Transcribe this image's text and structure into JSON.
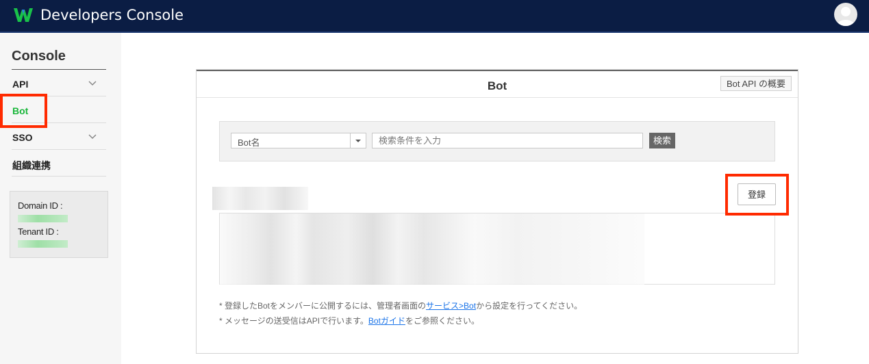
{
  "header": {
    "title": "Developers Console",
    "logo_color": "#19c24a",
    "bg_color": "#0b1d44"
  },
  "sidebar": {
    "heading": "Console",
    "items": [
      {
        "label": "API",
        "expandable": true
      },
      {
        "label": "Bot",
        "active": true
      },
      {
        "label": "SSO",
        "expandable": true
      },
      {
        "label": "組織連携"
      }
    ],
    "domain_id_label": "Domain ID :",
    "tenant_id_label": "Tenant ID :"
  },
  "panel": {
    "title": "Bot",
    "overview_button": "Bot API の概要",
    "search": {
      "field_select": "Bot名",
      "input_placeholder": "検索条件を入力",
      "button": "検索"
    },
    "register_button": "登録",
    "notes": {
      "note1_prefix": "* 登録したBotをメンバーに公開するには、管理者画面の",
      "note1_link": "サービス>Bot",
      "note1_suffix": "から設定を行ってください。",
      "note2_prefix": "* メッセージの送受信はAPIで行います。",
      "note2_link": "Botガイド",
      "note2_suffix": "をご参照ください。"
    }
  },
  "colors": {
    "active_green": "#19b63a",
    "highlight_red": "#ff2a00",
    "link_blue": "#1a73e8"
  }
}
